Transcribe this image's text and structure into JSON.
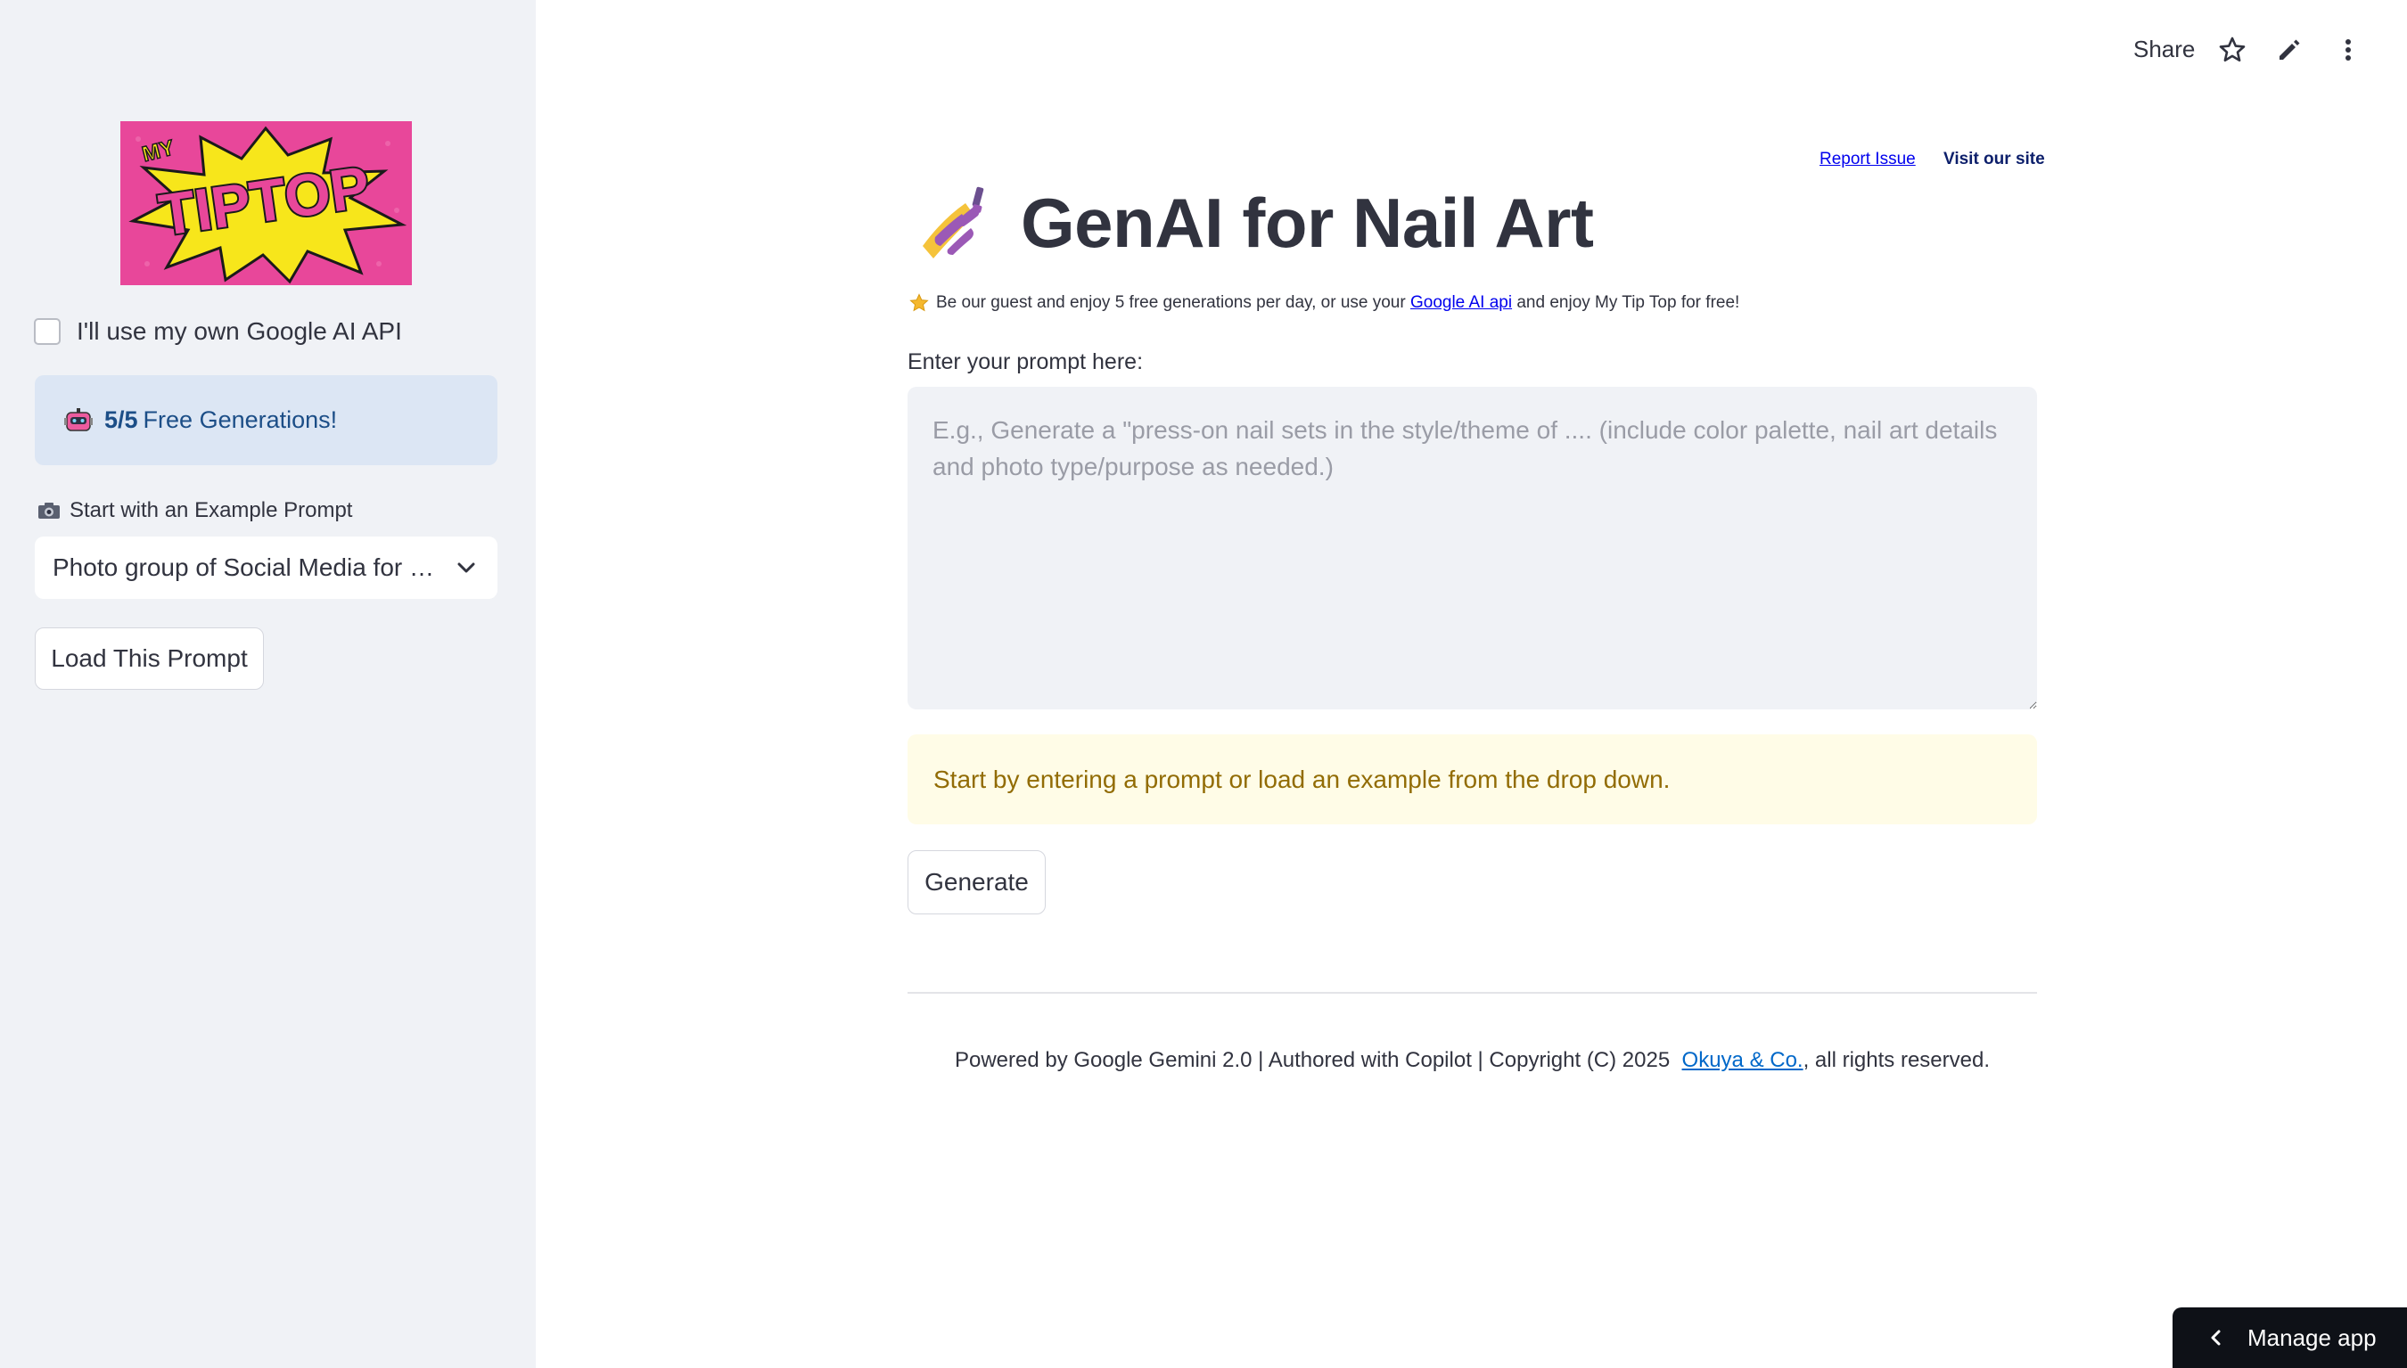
{
  "sidebar": {
    "logo": {
      "top_text": "MY",
      "main_text": "TIPTOP",
      "background_color": "#e8479a",
      "burst_color": "#f7e61b"
    },
    "api_checkbox": {
      "label": "I'll use my own Google AI API",
      "checked": false
    },
    "free_generations": {
      "icon": "robot-icon",
      "count": "5/5",
      "text": "Free Generations!"
    },
    "example_prompt": {
      "icon": "camera-icon",
      "label": "Start with an Example Prompt",
      "selected_value": "Photo group of Social Media for Press-on Nails"
    },
    "load_button_label": "Load This Prompt"
  },
  "toolbar": {
    "share_label": "Share",
    "icons": [
      "star-icon",
      "pencil-icon",
      "more-vertical-icon"
    ]
  },
  "header_links": {
    "report_issue": "Report Issue",
    "visit_site": "Visit our site"
  },
  "main": {
    "title_icon": "nail-polish-icon",
    "title": "GenAI for Nail Art",
    "info": {
      "icon": "star-icon",
      "text_before": "Be our guest and enjoy 5 free generations per day, or use your",
      "link_text": "Google AI api",
      "text_after": "and enjoy My Tip Top for free!"
    },
    "prompt_label": "Enter your prompt here:",
    "prompt_value": "",
    "prompt_placeholder": "E.g., Generate a \"press-on nail sets in the style/theme of .... (include color palette, nail art details and photo type/purpose as needed.)",
    "warning": "Start by entering a prompt or load an example from the drop down.",
    "generate_label": "Generate"
  },
  "footer": {
    "text_before": "Powered by Google Gemini 2.0 | Authored with Copilot | Copyright (C) 2025",
    "link_text": "Okuya & Co.",
    "text_after": ", all rights reserved."
  },
  "manage_app_label": "Manage app",
  "colors": {
    "sidebar_bg": "#f0f2f6",
    "info_blue_bg": "#dce6f4",
    "info_blue_text": "#1c4e87",
    "warning_bg": "#fffce7",
    "warning_text": "#926c05",
    "link_blue": "#0068c9",
    "manage_bg": "#0e1117"
  }
}
